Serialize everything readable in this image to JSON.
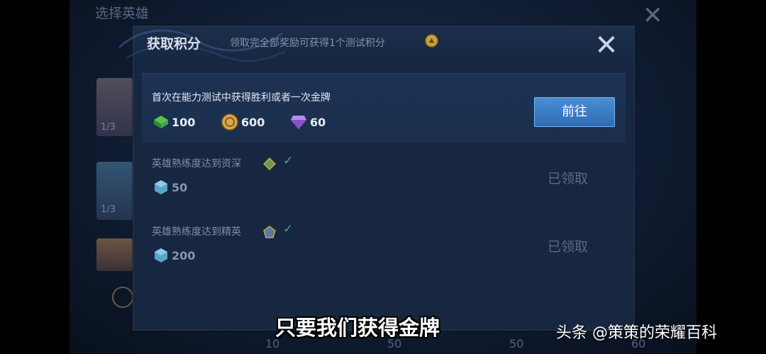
{
  "background": {
    "title": "选择英雄",
    "counts": [
      "1/3",
      "1/3"
    ],
    "bottom_numbers": [
      "10",
      "50",
      "50",
      "60"
    ]
  },
  "modal": {
    "title": "获取积分",
    "subtitle": "领取完全部奖励可获得1个测试积分",
    "close_icon": "close-icon"
  },
  "tasks": [
    {
      "title": "首次在能力测试中获得胜利或者一次金牌",
      "rewards": [
        {
          "icon": "green-gem-icon",
          "value": "100"
        },
        {
          "icon": "gold-coin-icon",
          "value": "600"
        },
        {
          "icon": "purple-diamond-icon",
          "value": "60"
        }
      ],
      "action_label": "前往"
    },
    {
      "title": "英雄熟练度达到资深",
      "rewards": [
        {
          "icon": "blue-crystal-icon",
          "value": "50"
        }
      ],
      "status": "已领取"
    },
    {
      "title": "英雄熟练度达到精英",
      "rewards": [
        {
          "icon": "blue-crystal-icon",
          "value": "200"
        }
      ],
      "status": "已领取"
    }
  ],
  "caption": "只要我们获得金牌",
  "watermark": "头条 @策策的荣耀百科",
  "colors": {
    "accent_button": "#3a7fc8",
    "check_green": "#3fae7a",
    "modal_bg": "#17273f"
  }
}
